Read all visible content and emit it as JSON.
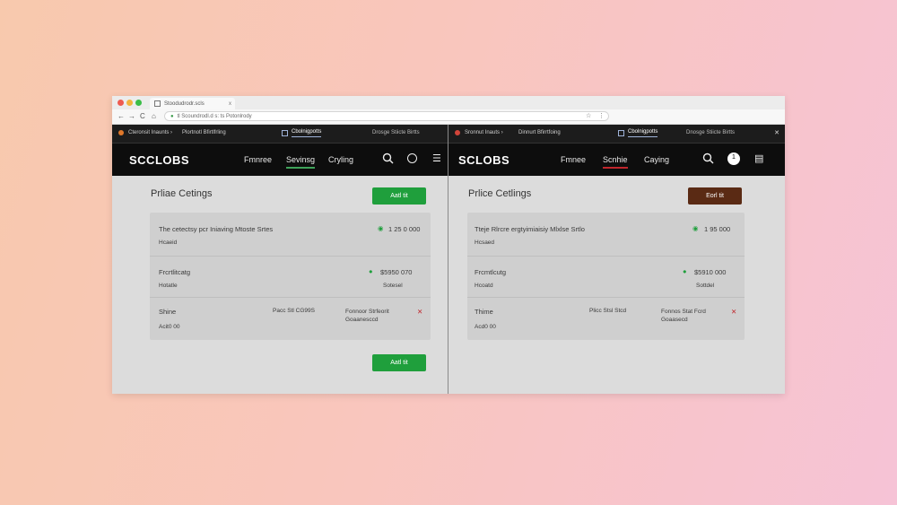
{
  "browser": {
    "tab_title": "Stoodudrodr.scls",
    "tab_close": "x",
    "url": "tl  Scoundrodl.d s: ts Potonlrody",
    "back": "←",
    "forward": "→",
    "reload": "C"
  },
  "left": {
    "subbar": {
      "crumb": "Cteronsit Inaunts  ›",
      "crumb2": "Plortnotl Bfirtlfrling",
      "active_tab": "Cbolnigpotts",
      "right_text": "Drosge Stiicte  Birtts",
      "close": "✕"
    },
    "appbar": {
      "brand": "SCCLOBS",
      "nav": [
        "Fmnree",
        "Sevinsg",
        "Cryling"
      ]
    },
    "page_title": "Prliae Cetings",
    "top_button": "Aatl tit",
    "bottom_button": "Aatl tit",
    "card": {
      "row1_title": "The cetectsy pcr Iniaving Mtoste Srtes",
      "row1_sub": "Hcaeid",
      "row1_value": "1  25 0 000",
      "row2_title": "Frcrtlitcatg",
      "row2_sub": "Hotatle",
      "row2_value": "$5950 070",
      "row2_status": "Sotesel",
      "row3_title": "Shine",
      "row3_sub": "Acit0 00",
      "row3_mid": "Pacc Stl CG99S",
      "row3_right": "Fonnoor Strfeorit Goaanesccd",
      "row3_x": "✕"
    }
  },
  "right": {
    "subbar": {
      "crumb": "Sronnut Inauts  ›",
      "crumb2": "Dinnurt Bfirrtfoing",
      "active_tab": "Cbolnigpotts",
      "right_text": "Dnosge Stiicte  Birtts",
      "close": "✕"
    },
    "appbar": {
      "brand": "SCLOBS",
      "nav": [
        "Fmnee",
        "Scnhie",
        "Caying"
      ]
    },
    "page_title": "Prlice Cetlings",
    "top_button": "Eorl tit",
    "card": {
      "row1_title": "Tteje Rlrcre ergtyimiaisiy Mlxlse Srtlo",
      "row1_sub": "Hcsaed",
      "row1_value": "1  95 000",
      "row2_title": "Frcmtlcutg",
      "row2_sub": "Hcoatd",
      "row2_value": "$5910 000",
      "row2_status": "Sottdel",
      "row3_title": "Thime",
      "row3_sub": "Acd0 00",
      "row3_mid": "Plicc Stsl Stcd",
      "row3_right": "Fonnos Stat Fcrd Goaasecd",
      "row3_x": "✕"
    }
  },
  "colors": {
    "accent_green": "#1f9f3c",
    "accent_brown": "#5a2a14",
    "accent_red": "#c0262c",
    "appbar_bg": "#0d0d0d"
  }
}
